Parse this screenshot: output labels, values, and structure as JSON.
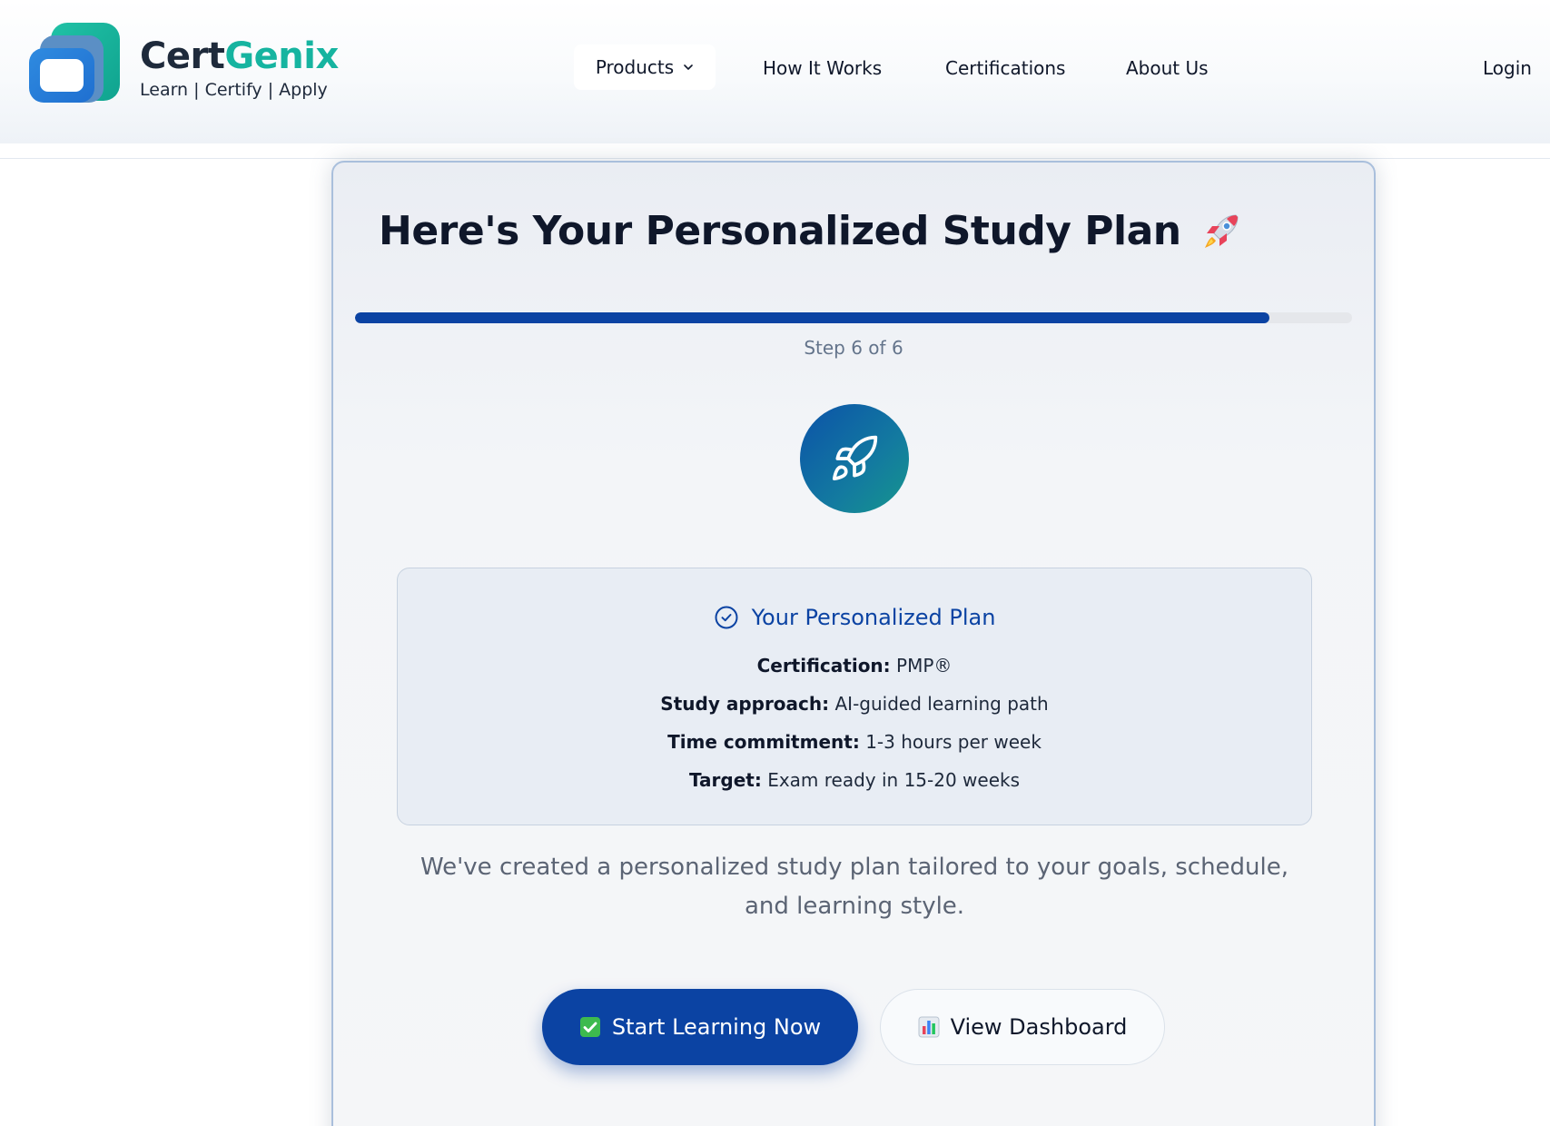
{
  "header": {
    "brand": {
      "part1": "Cert",
      "part2": "Genix",
      "tagline": "Learn | Certify | Apply"
    },
    "nav": {
      "products": "Products",
      "how_it_works": "How It Works",
      "certifications": "Certifications",
      "about_us": "About Us",
      "login": "Login"
    }
  },
  "card": {
    "title": "Here's Your Personalized Study Plan",
    "progress": {
      "current_step": 6,
      "total_steps": 6,
      "fill_fraction": 0.917,
      "label": "Step 6 of 6"
    },
    "plan": {
      "heading": "Your Personalized Plan",
      "rows": [
        {
          "label": "Certification:",
          "value": "PMP®"
        },
        {
          "label": "Study approach:",
          "value": "AI-guided learning path"
        },
        {
          "label": "Time commitment:",
          "value": "1-3 hours per week"
        },
        {
          "label": "Target:",
          "value": "Exam ready in 15-20 weeks"
        }
      ]
    },
    "description": "We've created a personalized study plan tailored to your goals, schedule, and learning style.",
    "buttons": {
      "primary": "Start Learning Now",
      "secondary": "View Dashboard"
    }
  },
  "colors": {
    "primary": "#0b43a3",
    "brand_teal": "#16b4a0",
    "brand_dark": "#1e2a3b"
  },
  "icons": {
    "title_emoji": "rocket-emoji",
    "hero": "rocket-icon",
    "plan_heading": "check-circle-icon",
    "primary_button": "check-box-emoji",
    "secondary_button": "bar-chart-emoji"
  }
}
